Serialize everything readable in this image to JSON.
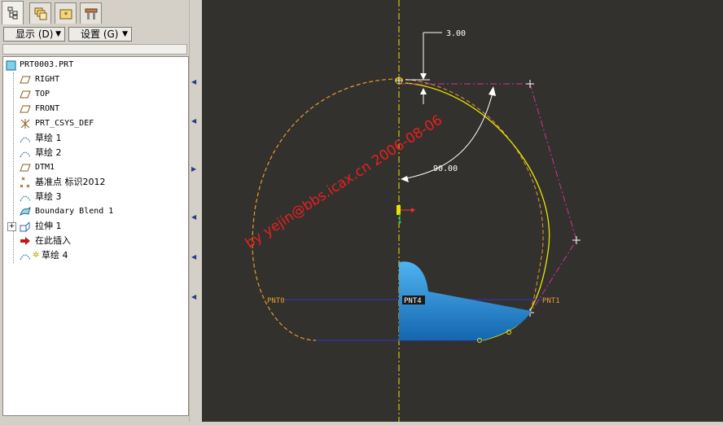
{
  "toolbar": {
    "tabs": [
      {
        "icon": "model-tree-icon"
      },
      {
        "icon": "layers-icon"
      },
      {
        "icon": "folder-browser-icon"
      },
      {
        "icon": "favorites-icon"
      }
    ],
    "show_label": "显示 (D)",
    "settings_label": "设置 (G)"
  },
  "tree": {
    "items": [
      {
        "label": "PRT0003.PRT",
        "icon": "part-icon"
      },
      {
        "label": "RIGHT",
        "icon": "datum-plane-icon"
      },
      {
        "label": "TOP",
        "icon": "datum-plane-icon"
      },
      {
        "label": "FRONT",
        "icon": "datum-plane-icon"
      },
      {
        "label": "PRT_CSYS_DEF",
        "icon": "coordinate-system-icon"
      },
      {
        "label": "草绘 1",
        "icon": "sketch-icon"
      },
      {
        "label": "草绘 2",
        "icon": "sketch-icon"
      },
      {
        "label": "DTM1",
        "icon": "datum-plane-icon"
      },
      {
        "label": "基准点 标识2012",
        "icon": "datum-point-icon"
      },
      {
        "label": "草绘 3",
        "icon": "sketch-icon"
      },
      {
        "label": "Boundary Blend 1",
        "icon": "boundary-blend-icon"
      },
      {
        "label": "拉伸 1",
        "icon": "extrude-icon"
      },
      {
        "label": "在此插入",
        "icon": "insert-here-arrow-icon"
      },
      {
        "label": "草绘 4",
        "icon": "sketch-icon"
      }
    ]
  },
  "canvas": {
    "dimension_top": "3.00",
    "dimension_angle": "90.00",
    "point_left": "PNT0",
    "point_mid": "PNT4",
    "point_right": "PNT1",
    "watermark": "by yejin@bbs.icax.cn 2006-08-06",
    "colors": {
      "background": "#33312e",
      "curve_yellow": "#e6e600",
      "curve_dashed": "#e69a2e",
      "polygon_magenta": "#cc3399",
      "line_blue": "#3333cc",
      "surface_blue": "#2a8ed6",
      "watermark_red": "#e8201e"
    }
  }
}
